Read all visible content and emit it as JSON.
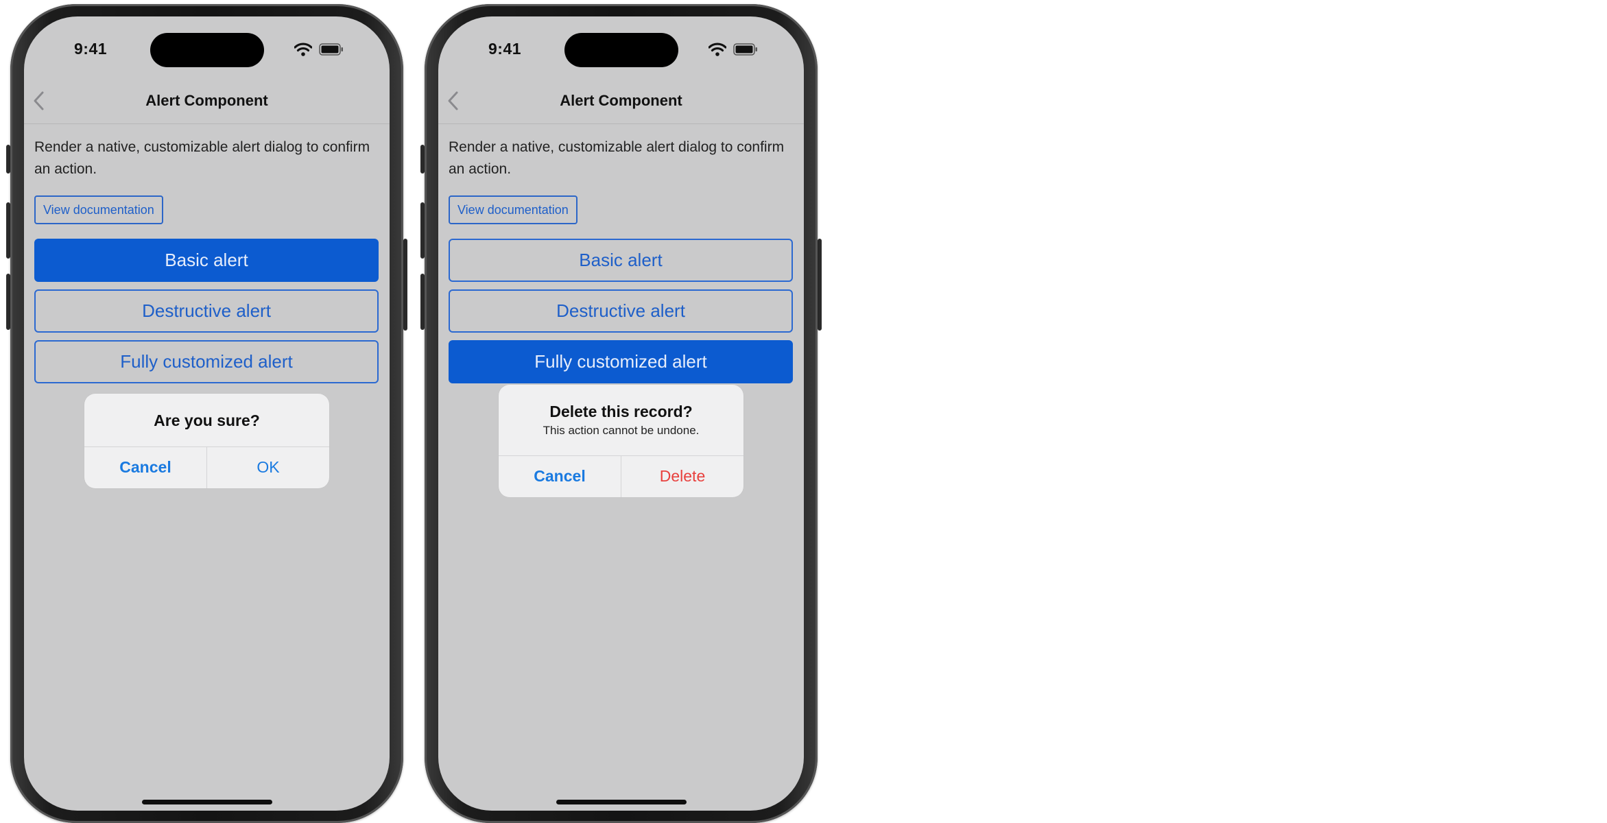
{
  "phones": [
    {
      "status_bar": {
        "time": "9:41"
      },
      "nav": {
        "title": "Alert Component",
        "back_icon": "chevron-left-icon"
      },
      "description": "Render a native, customizable alert dialog to confirm an action.",
      "doc_link": "View documentation",
      "buttons": [
        {
          "label": "Basic alert",
          "active": true
        },
        {
          "label": "Destructive alert",
          "active": false
        },
        {
          "label": "Fully customized alert",
          "active": false
        }
      ],
      "alert": {
        "title": "Are you sure?",
        "message": "",
        "cancel": "Cancel",
        "confirm": "OK"
      }
    },
    {
      "status_bar": {
        "time": "9:41"
      },
      "nav": {
        "title": "Alert Component",
        "back_icon": "chevron-left-icon"
      },
      "description": "Render a native, customizable alert dialog to confirm an action.",
      "doc_link": "View documentation",
      "buttons": [
        {
          "label": "Basic alert",
          "active": false
        },
        {
          "label": "Destructive alert",
          "active": false
        },
        {
          "label": "Fully customized alert",
          "active": true
        }
      ],
      "alert": {
        "title": "Delete this record?",
        "message": "This action cannot be undone.",
        "cancel": "Cancel",
        "confirm": "Delete"
      }
    }
  ],
  "colors": {
    "screen_bg": "#cacacb",
    "primary": "#0c5bd0",
    "link": "#1e5fc9",
    "alert_action": "#1a7ae0",
    "destructive": "#e8403d"
  }
}
